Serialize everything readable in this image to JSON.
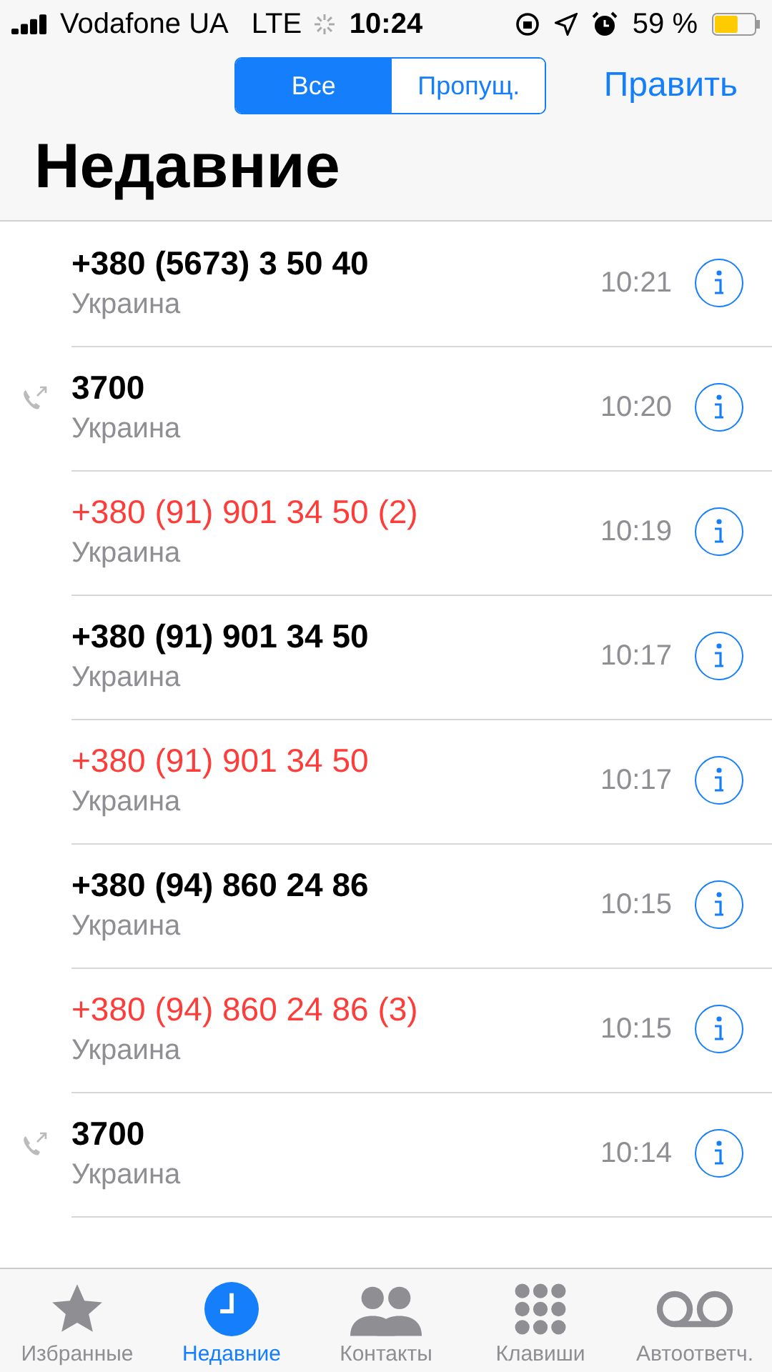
{
  "status_bar": {
    "carrier": "Vodafone UA",
    "network": "LTE",
    "time": "10:24",
    "battery_text": "59 %",
    "battery": {
      "level": 0.59
    }
  },
  "segments": [
    {
      "label": "Все",
      "selected": true
    },
    {
      "label": "Пропущ.",
      "selected": false
    }
  ],
  "edit_button": "Править",
  "title": "Недавние",
  "calls": [
    {
      "number": "+380 (5673) 3 50 40",
      "location": "Украина",
      "time": "10:21",
      "missed": false,
      "outgoing": false
    },
    {
      "number": "3700",
      "location": "Украина",
      "time": "10:20",
      "missed": false,
      "outgoing": true
    },
    {
      "number": "+380 (91) 901 34 50 (2)",
      "location": "Украина",
      "time": "10:19",
      "missed": true,
      "outgoing": false
    },
    {
      "number": "+380 (91) 901 34 50",
      "location": "Украина",
      "time": "10:17",
      "missed": false,
      "outgoing": false
    },
    {
      "number": "+380 (91) 901 34 50",
      "location": "Украина",
      "time": "10:17",
      "missed": true,
      "outgoing": false
    },
    {
      "number": "+380 (94) 860 24 86",
      "location": "Украина",
      "time": "10:15",
      "missed": false,
      "outgoing": false
    },
    {
      "number": "+380 (94) 860 24 86 (3)",
      "location": "Украина",
      "time": "10:15",
      "missed": true,
      "outgoing": false
    },
    {
      "number": "3700",
      "location": "Украина",
      "time": "10:14",
      "missed": false,
      "outgoing": true
    }
  ],
  "tab_bar": [
    {
      "label": "Избранные",
      "kind": "star",
      "selected": false
    },
    {
      "label": "Недавние",
      "kind": "clock",
      "selected": true
    },
    {
      "label": "Контакты",
      "kind": "people",
      "selected": false
    },
    {
      "label": "Клавиши",
      "kind": "keypad",
      "selected": false
    },
    {
      "label": "Автоответч.",
      "kind": "voicemail",
      "selected": false
    }
  ]
}
